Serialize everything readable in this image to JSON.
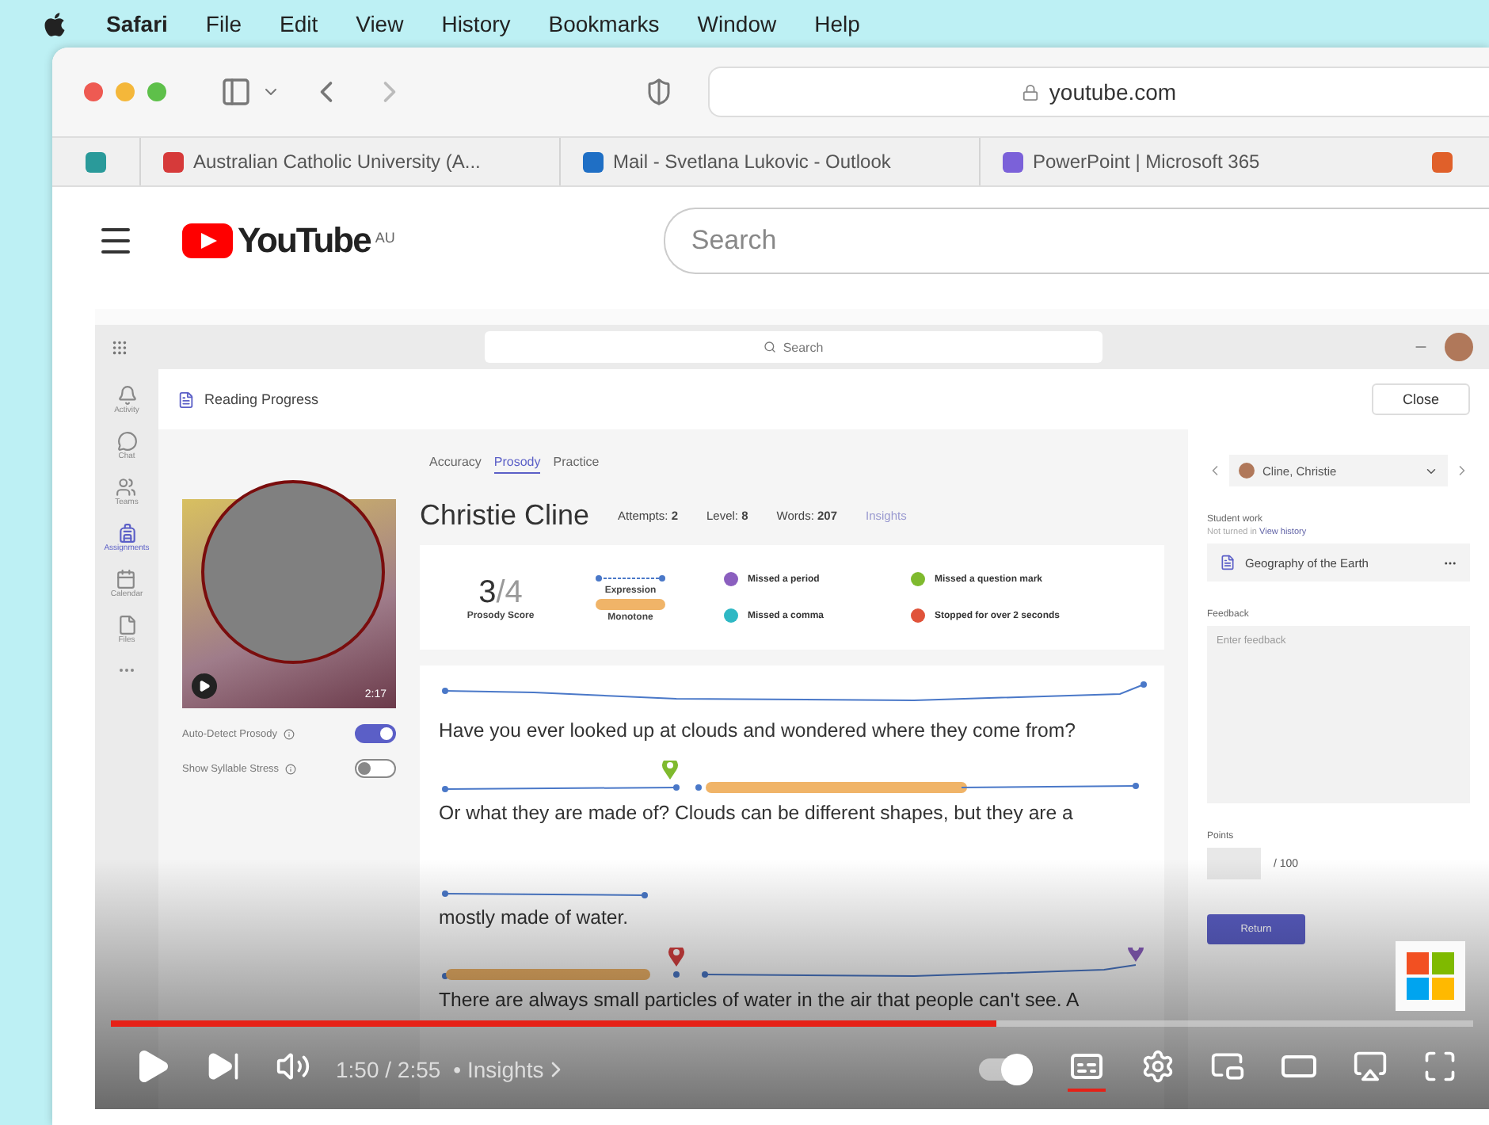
{
  "menubar": {
    "app": "Safari",
    "items": [
      "File",
      "Edit",
      "View",
      "History",
      "Bookmarks",
      "Window",
      "Help"
    ]
  },
  "browser": {
    "address": "youtube.com",
    "favorites": [
      {
        "label": "Australian Catholic University (A...",
        "color": "#d63a3a"
      },
      {
        "label": "Mail - Svetlana Lukovic - Outlook",
        "color": "#1f6fc5"
      },
      {
        "label": "PowerPoint | Microsoft 365",
        "color": "#7b61d9"
      }
    ]
  },
  "youtube": {
    "logo": "YouTube",
    "region": "AU",
    "search_placeholder": "Search"
  },
  "teams": {
    "search_placeholder": "Search",
    "rail": [
      {
        "label": "Activity",
        "selected": false
      },
      {
        "label": "Chat",
        "selected": false
      },
      {
        "label": "Teams",
        "selected": false
      },
      {
        "label": "Assignments",
        "selected": true
      },
      {
        "label": "Calendar",
        "selected": false
      },
      {
        "label": "Files",
        "selected": false
      }
    ],
    "app_title": "Reading Progress",
    "close": "Close",
    "tabs": [
      {
        "label": "Accuracy",
        "selected": false
      },
      {
        "label": "Prosody",
        "selected": true
      },
      {
        "label": "Practice",
        "selected": false
      }
    ],
    "video_time": "2:17",
    "toggles": [
      {
        "label": "Auto-Detect Prosody",
        "on": true
      },
      {
        "label": "Show Syllable Stress",
        "on": false
      }
    ],
    "student": "Christie Cline",
    "stats": [
      {
        "label": "Attempts:",
        "value": "2"
      },
      {
        "label": "Level:",
        "value": "8"
      },
      {
        "label": "Words:",
        "value": "207"
      }
    ],
    "insights": "Insights",
    "score": {
      "value": "3",
      "total": "/4",
      "label": "Prosody Score"
    },
    "scale": {
      "high": "Expression",
      "low": "Monotone"
    },
    "legend": [
      {
        "label": "Missed a period",
        "color": "#8b5fbf"
      },
      {
        "label": "Missed a question mark",
        "color": "#7fba2e"
      },
      {
        "label": "Missed a comma",
        "color": "#2fb8c4"
      },
      {
        "label": "Stopped for over 2 seconds",
        "color": "#e0533a"
      }
    ],
    "passage": [
      "Have you ever looked up at clouds and wondered where they come from?",
      "Or what they are made of?  Clouds can be different shapes, but they are a",
      "mostly made of water.",
      "There are always small particles of water in the air that people can't see. A"
    ],
    "panel": {
      "student": "Cline, Christie",
      "work_label": "Student work",
      "status": "Not turned in",
      "history_link": "View history",
      "file": "Geography of the Earth",
      "feedback_label": "Feedback",
      "feedback_placeholder": "Enter feedback",
      "points_label": "Points",
      "points_total": "/ 100",
      "return": "Return"
    }
  },
  "player": {
    "time": "1:50 / 2:55",
    "chapter": "• Insights",
    "level": 0.65,
    "autoplay_on": true,
    "captions_on": true
  }
}
